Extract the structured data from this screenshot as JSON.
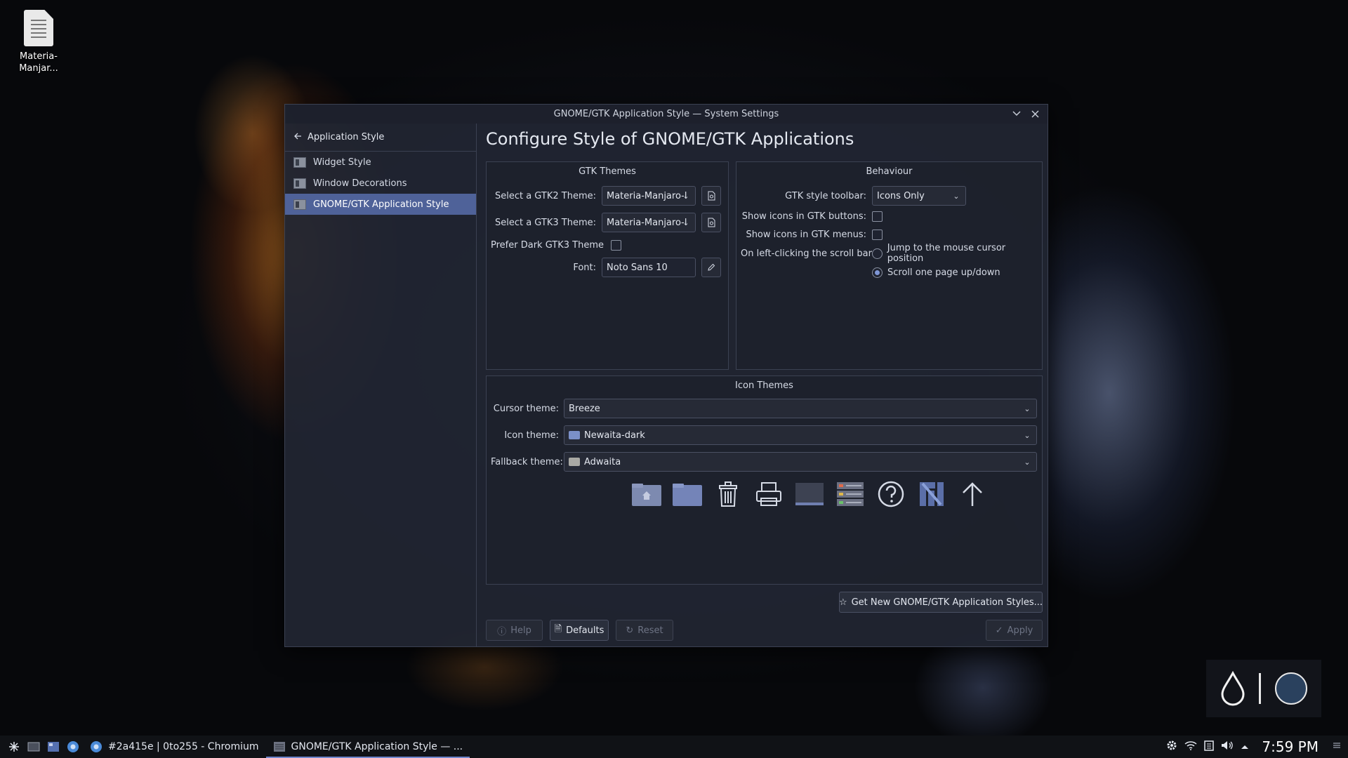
{
  "desktop": {
    "file_label_line1": "Materia-",
    "file_label_line2": "Manjar..."
  },
  "window": {
    "title": "GNOME/GTK Application Style — System Settings"
  },
  "sidebar": {
    "back_label": "Application Style",
    "items": [
      {
        "label": "Widget Style"
      },
      {
        "label": "Window Decorations"
      },
      {
        "label": "GNOME/GTK Application Style",
        "active": true
      }
    ]
  },
  "main": {
    "heading": "Configure Style of GNOME/GTK Applications"
  },
  "gtk_themes": {
    "title": "GTK Themes",
    "gtk2_label": "Select a GTK2 Theme:",
    "gtk2_value": "Materia-Manjaro-l",
    "gtk3_label": "Select a GTK3 Theme:",
    "gtk3_value": "Materia-Manjaro-l",
    "prefer_dark_label": "Prefer Dark GTK3 Theme",
    "prefer_dark_checked": false,
    "font_label": "Font:",
    "font_value": "Noto Sans 10"
  },
  "behaviour": {
    "title": "Behaviour",
    "toolbar_label": "GTK style toolbar:",
    "toolbar_value": "Icons Only",
    "buttons_icons_label": "Show icons in GTK buttons:",
    "buttons_icons_checked": false,
    "menus_icons_label": "Show icons in GTK menus:",
    "menus_icons_checked": false,
    "scrollbar_label": "On left-clicking the scroll bar:",
    "scroll_option1": "Jump to the mouse cursor position",
    "scroll_option2": "Scroll one page up/down",
    "scroll_selected": 2
  },
  "icon_themes": {
    "title": "Icon Themes",
    "cursor_label": "Cursor theme:",
    "cursor_value": "Breeze",
    "icon_label": "Icon theme:",
    "icon_value": "Newaita-dark",
    "fallback_label": "Fallback theme:",
    "fallback_value": "Adwaita",
    "preview_icons": [
      "folder-home-icon",
      "folder-icon",
      "trash-icon",
      "printer-icon",
      "computer-icon",
      "server-icon",
      "help-icon",
      "manjaro-icon",
      "up-arrow-icon"
    ]
  },
  "buttons": {
    "get_new": "Get New GNOME/GTK Application Styles...",
    "help": "Help",
    "defaults": "Defaults",
    "reset": "Reset",
    "apply": "Apply"
  },
  "taskbar": {
    "task1": "#2a415e | 0to255 - Chromium",
    "task2": "GNOME/GTK Application Style — ...",
    "clock": "7:59 PM"
  },
  "colors": {
    "accent": "#4f6299",
    "window_bg": "#212532",
    "taskbar_bg": "#101216"
  }
}
